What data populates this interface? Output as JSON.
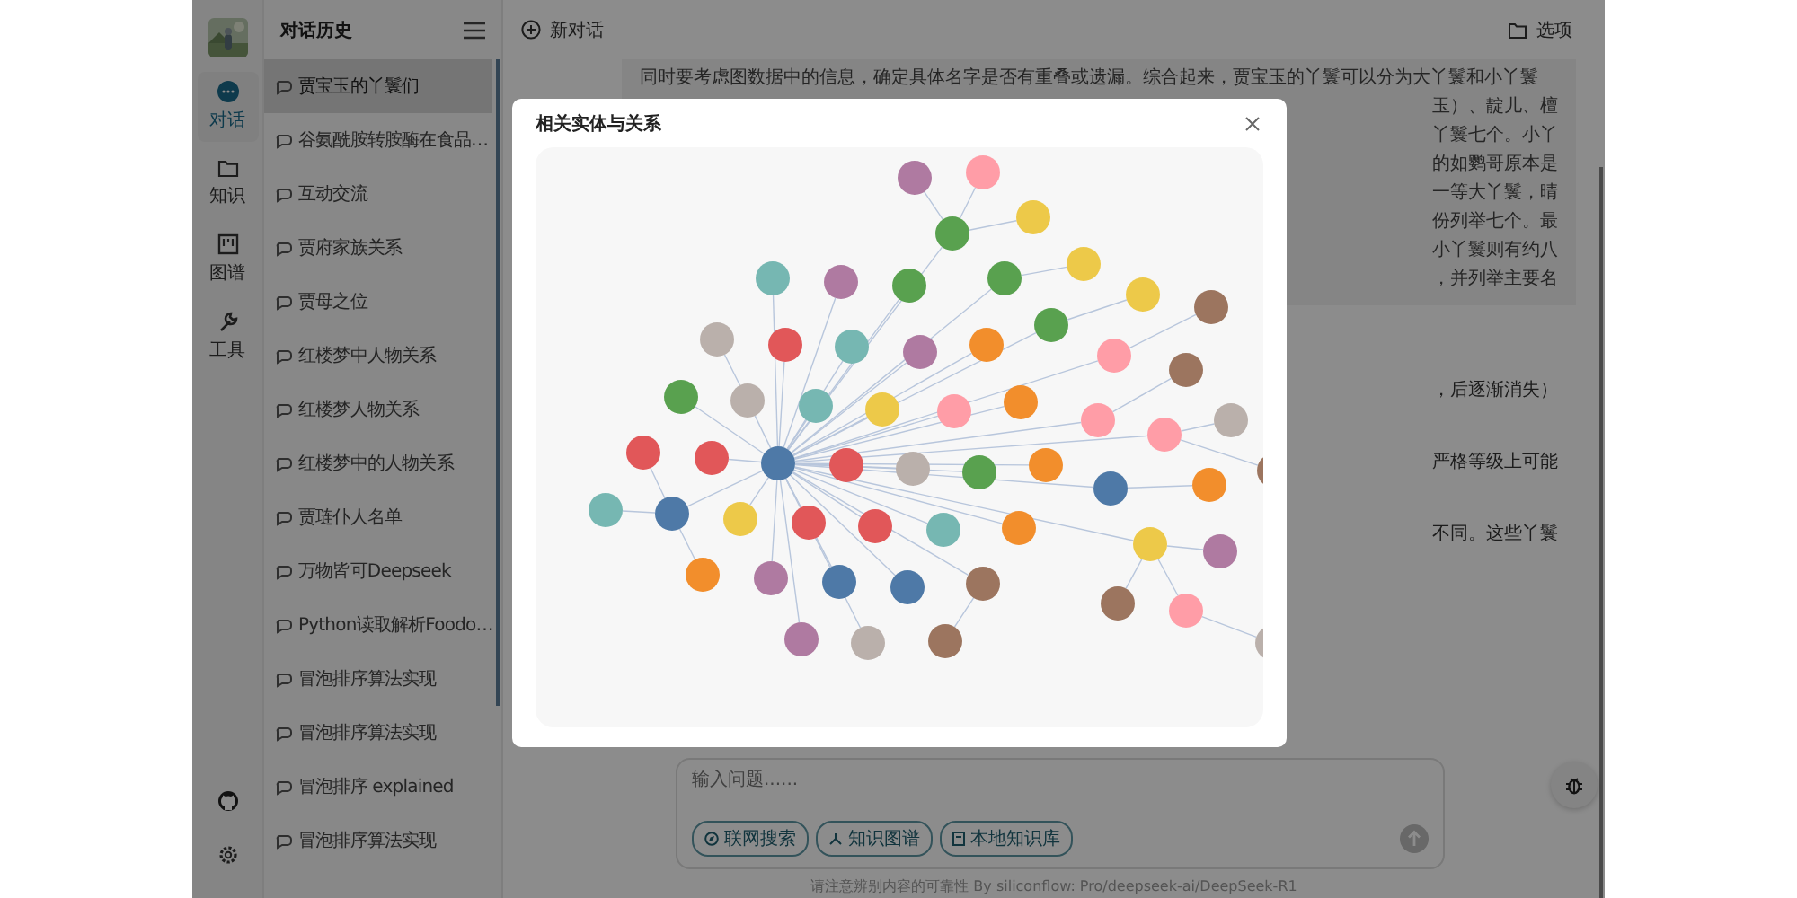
{
  "nav": [
    {
      "label": "对话",
      "selected": true
    },
    {
      "label": "知识",
      "selected": false
    },
    {
      "label": "图谱",
      "selected": false
    },
    {
      "label": "工具",
      "selected": false
    }
  ],
  "history": {
    "title": "对话历史",
    "items": [
      {
        "title": "贾宝玉的丫鬟们",
        "selected": true
      },
      {
        "title": "谷氨酰胺转胺酶在食品…",
        "selected": false
      },
      {
        "title": "互动交流",
        "selected": false
      },
      {
        "title": "贾府家族关系",
        "selected": false
      },
      {
        "title": "贾母之位",
        "selected": false
      },
      {
        "title": "红楼梦中人物关系",
        "selected": false
      },
      {
        "title": "红楼梦人物关系",
        "selected": false
      },
      {
        "title": "红楼梦中的人物关系",
        "selected": false
      },
      {
        "title": "贾琏仆人名单",
        "selected": false
      },
      {
        "title": "万物皆可Deepseek",
        "selected": false
      },
      {
        "title": "Python读取解析Foodo…",
        "selected": false
      },
      {
        "title": "冒泡排序算法实现",
        "selected": false
      },
      {
        "title": "冒泡排序算法实现",
        "selected": false
      },
      {
        "title": "冒泡排序 explained",
        "selected": false
      },
      {
        "title": "冒泡排序算法实现",
        "selected": false
      }
    ]
  },
  "topbar": {
    "new_chat": "新对话",
    "options": "选项"
  },
  "message": {
    "lines": [
      "同时要考虑图数据中的信息，确定具体名字是否有重叠或遗漏。综合起来，贾宝玉的丫鬟可以分为大丫鬟和小丫鬟"
    ],
    "fragments": [
      "玉）、靛儿、檀",
      "丫鬟七个。小丫",
      "的如鹦哥原本是",
      "一等大丫鬟，晴",
      "份列举七个。最",
      "小丫鬟则有约八",
      "，并列举主要名"
    ]
  },
  "answer_fragments": [
    "，后逐渐消失）",
    "严格等级上可能",
    "不同。这些丫鬟"
  ],
  "composer": {
    "placeholder": "输入问题......",
    "tools": [
      "联网搜索",
      "知识图谱",
      "本地知识库"
    ]
  },
  "footer": "请注意辨别内容的可靠性 By siliconflow: Pro/deepseek-ai/DeepSeek-R1",
  "modal": {
    "title": "相关实体与关系",
    "graph": {
      "nodes": [
        {
          "color": "#af7aa1"
        },
        {
          "color": "#ff9da7"
        },
        {
          "color": "#59a14f"
        },
        {
          "color": "#edc949"
        },
        {
          "color": "#76b7b2"
        },
        {
          "color": "#af7aa1"
        },
        {
          "color": "#59a14f"
        },
        {
          "color": "#59a14f"
        },
        {
          "color": "#edc949"
        },
        {
          "color": "#edc949"
        },
        {
          "color": "#9c755f"
        },
        {
          "color": "#bab0ab"
        },
        {
          "color": "#e15759"
        },
        {
          "color": "#76b7b2"
        },
        {
          "color": "#af7aa1"
        },
        {
          "color": "#f28e2c"
        },
        {
          "color": "#59a14f"
        },
        {
          "color": "#ff9da7"
        },
        {
          "color": "#9c755f"
        },
        {
          "color": "#59a14f"
        },
        {
          "color": "#bab0ab"
        },
        {
          "color": "#76b7b2"
        },
        {
          "color": "#edc949"
        },
        {
          "color": "#ff9da7"
        },
        {
          "color": "#f28e2c"
        },
        {
          "color": "#ff9da7"
        },
        {
          "color": "#ff9da7"
        },
        {
          "color": "#bab0ab"
        },
        {
          "color": "#e15759"
        },
        {
          "color": "#e15759"
        },
        {
          "color": "#4e79a7"
        },
        {
          "color": "#e15759"
        },
        {
          "color": "#bab0ab"
        },
        {
          "color": "#59a14f"
        },
        {
          "color": "#f28e2c"
        },
        {
          "color": "#4e79a7"
        },
        {
          "color": "#f28e2c"
        },
        {
          "color": "#76b7b2"
        },
        {
          "color": "#4e79a7"
        },
        {
          "color": "#edc949"
        },
        {
          "color": "#e15759"
        },
        {
          "color": "#e15759"
        },
        {
          "color": "#76b7b2"
        },
        {
          "color": "#f28e2c"
        },
        {
          "color": "#edc949"
        },
        {
          "color": "#af7aa1"
        },
        {
          "color": "#f28e2c"
        },
        {
          "color": "#af7aa1"
        },
        {
          "color": "#4e79a7"
        },
        {
          "color": "#4e79a7"
        },
        {
          "color": "#9c755f"
        },
        {
          "color": "#9c755f"
        },
        {
          "color": "#ff9da7"
        },
        {
          "color": "#af7aa1"
        },
        {
          "color": "#bab0ab"
        },
        {
          "color": "#9c755f"
        },
        {
          "color": "#9c755f"
        },
        {
          "color": "#bab0ab"
        }
      ]
    }
  }
}
